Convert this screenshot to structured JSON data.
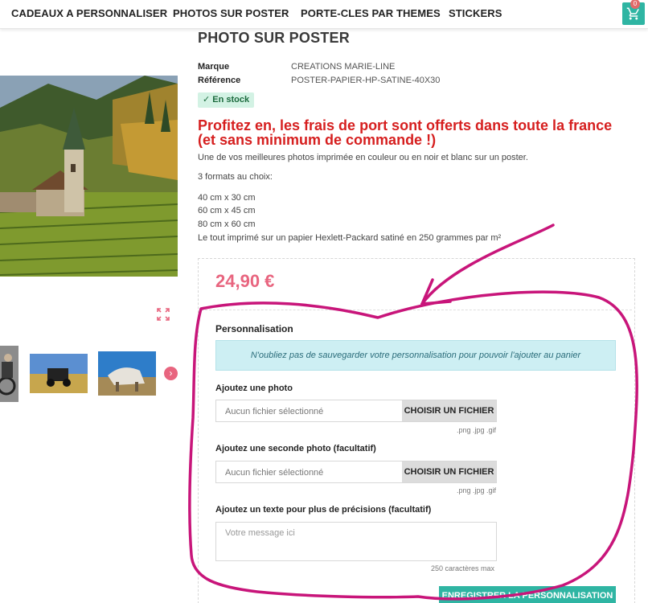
{
  "nav": {
    "items": [
      "CADEAUX A PERSONNALISER",
      "PHOTOS SUR POSTER",
      "PORTE-CLES PAR THEMES",
      "STICKERS"
    ],
    "cart_count": "0"
  },
  "product": {
    "title": "PHOTO SUR POSTER",
    "brand_label": "Marque",
    "brand_value": "CREATIONS MARIE-LINE",
    "ref_label": "Référence",
    "ref_value": "POSTER-PAPIER-HP-SATINE-40X30",
    "stock": "En stock",
    "promo": "Profitez en, les frais de port sont offerts dans toute la france (et sans minimum de commande !)",
    "description": [
      "Une de vos meilleures photos imprimée en couleur ou en noir et blanc sur un poster.",
      "3 formats au choix:",
      "40 cm x 30 cm",
      "60 cm x 45 cm",
      "80 cm x 60 cm",
      "Le tout imprimé sur un papier Hexlett-Packard satiné en 250 grammes par m²"
    ],
    "price": "24,90 €"
  },
  "personalization": {
    "title": "Personnalisation",
    "notice": "N'oubliez pas de sauvegarder votre personnalisation pour pouvoir l'ajouter au panier",
    "photo1_label": "Ajoutez une photo",
    "photo2_label": "Ajoutez une seconde photo (facultatif)",
    "file_placeholder": "Aucun fichier sélectionné",
    "file_button": "CHOISIR UN FICHIER",
    "file_hint": ".png .jpg .gif",
    "text_label": "Ajoutez un texte pour plus de précisions (facultatif)",
    "text_placeholder": "Votre message ici",
    "text_hint": "250 caractères max",
    "save_button": "ENREGISTRER LA PERSONNALISATION"
  },
  "colors": {
    "accent": "#2fb5a3",
    "price": "#e8657f",
    "promo": "#d61f1f",
    "annotation": "#c8157a"
  }
}
